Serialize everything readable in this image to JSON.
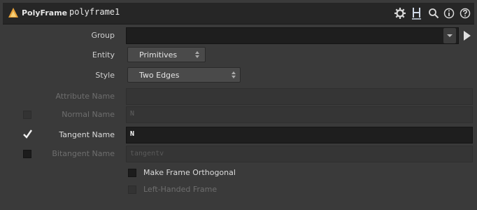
{
  "header": {
    "node_type": "PolyFrame",
    "node_name": "polyframe1",
    "icons": [
      "gear-icon",
      "help-h-icon",
      "magnifier-icon",
      "info-icon",
      "question-icon"
    ]
  },
  "params": {
    "group": {
      "label": "Group",
      "value": ""
    },
    "entity": {
      "label": "Entity",
      "value": "Primitives"
    },
    "style": {
      "label": "Style",
      "value": "Two Edges"
    },
    "attribute_name": {
      "label": "Attribute Name",
      "value": ""
    },
    "normal_name": {
      "label": "Normal Name",
      "value": "N",
      "enabled": false
    },
    "tangent_name": {
      "label": "Tangent Name",
      "value": "N",
      "enabled": true
    },
    "bitangent_name": {
      "label": "Bitangent Name",
      "value": "tangentv",
      "enabled": false
    },
    "make_orthogonal": {
      "label": "Make Frame Orthogonal",
      "checked": false
    },
    "left_handed": {
      "label": "Left-Handed Frame",
      "checked": false
    }
  },
  "colors": {
    "accent": "#e8a23a",
    "bg": "#3a3a3a",
    "header_bg": "#262626"
  }
}
